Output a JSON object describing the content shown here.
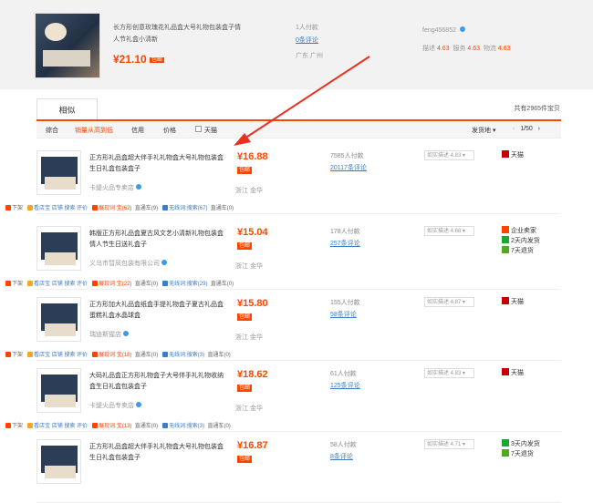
{
  "top": {
    "title": "长方形创意玫瑰花礼品盒大号礼物包装盒子情人节礼盒小清新",
    "price": "¥21.10",
    "price_badge": "包邮",
    "paid": "1人付款",
    "reviews": "0条评论",
    "location": "广东 广州",
    "seller": "feng456852",
    "scores": [
      {
        "label": "描述",
        "value": "4.63"
      },
      {
        "label": "服务",
        "value": "4.63"
      },
      {
        "label": "物流",
        "value": "4.63"
      }
    ]
  },
  "tabs": {
    "similar": "相似",
    "total": "共有2965件宝贝"
  },
  "sort": {
    "items": [
      "综合",
      "销量从高到低",
      "信用",
      "价格",
      "天猫"
    ],
    "shipfrom": "发货地",
    "pager": "1/50"
  },
  "rows": [
    {
      "title": "正方形礼品盒超大伴手礼礼物盒大号礼物包装盒生日礼盒包装盒子",
      "shop": "卡缇火品专卖店",
      "price": "¥16.88",
      "badge": "包邮",
      "paid": "7585人付款",
      "reviews": "20117条评论",
      "location": "浙江 金华",
      "desc": "如实描述 4.83",
      "tags": [
        "天猫"
      ],
      "actions": [
        "下架",
        "看店宝 店铺 搜索 评价",
        "展现词:宝(62)",
        "直通车(9)",
        "无线词:搜索(67)",
        "直通车(0)"
      ]
    },
    {
      "title": "韩版正方形礼品盒夏古风文艺小清新礼物包装盒情人节生日送礼盒子",
      "shop": "义乌市彗凤包装有限公司",
      "price": "¥15.04",
      "badge": "包邮",
      "paid": "178人付款",
      "reviews": "257条评论",
      "location": "浙江 金华",
      "desc": "如实描述 4.68",
      "tags": [
        "企业卖家",
        "2天内发货",
        "7天退货"
      ],
      "actions": [
        "下架",
        "看店宝 店铺 搜索 评价",
        "展现词:宝(22)",
        "直通车(0)",
        "无线词:搜索(29)",
        "直通车(0)"
      ]
    },
    {
      "title": "正方形加大礼品盒纸盒手提礼物盒子夏古礼品盒 蛋糕礼盒水晶球盒",
      "shop": "瑞迪斯猩店",
      "price": "¥15.80",
      "badge": "包邮",
      "paid": "155人付款",
      "reviews": "58条评论",
      "location": "浙江 金华",
      "desc": "如实描述 4.87",
      "tags": [
        "天猫"
      ],
      "actions": [
        "下架",
        "看店宝 店铺 搜索 评价",
        "展现词:宝(18)",
        "直通车(0)",
        "无线词:搜索(3)",
        "直通车(0)"
      ]
    },
    {
      "title": "大码礼品盒正方形礼物盒子大号伴手礼礼物收纳盒生日礼盒包装盒子",
      "shop": "卡缇火品专卖店",
      "price": "¥18.62",
      "badge": "包邮",
      "paid": "61人付款",
      "reviews": "125条评论",
      "location": "浙江 金华",
      "desc": "如实描述 4.83",
      "tags": [
        "天猫"
      ],
      "actions": [
        "下架",
        "看店宝 店铺 搜索 评价",
        "展现词:宝(13)",
        "直通车(0)",
        "无线词:搜索(3)",
        "直通车(0)"
      ]
    },
    {
      "title": "正方形礼品盒超大伴手礼礼物盒大号礼物包装盒生日礼盒包装盒子",
      "shop": "",
      "price": "¥16.87",
      "badge": "包邮",
      "paid": "58人付款",
      "reviews": "8条评论",
      "location": "",
      "desc": "如实描述 4.71",
      "tags": [
        "3天内发货",
        "7天退货"
      ],
      "actions": []
    }
  ],
  "colors": {
    "accent": "#ff4400",
    "link": "#3d7cc9",
    "arrow": "#e8311f"
  }
}
